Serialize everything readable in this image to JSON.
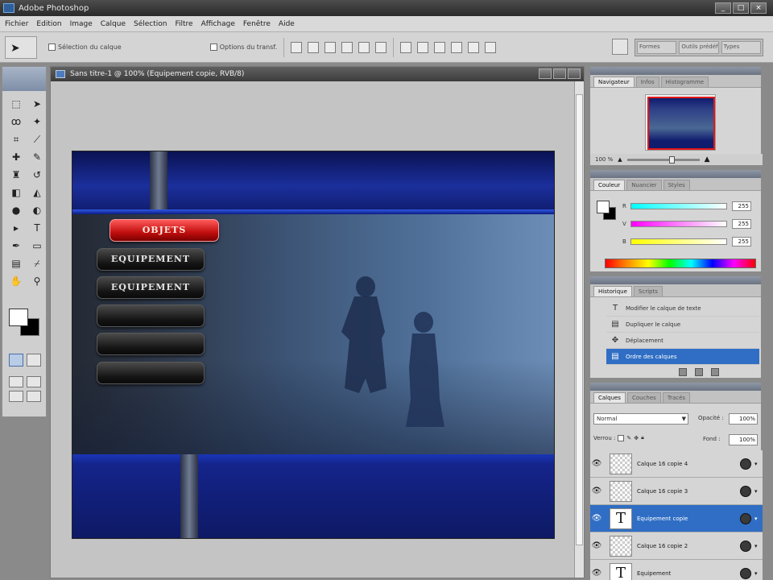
{
  "window": {
    "title": "Adobe Photoshop",
    "controls": [
      "_",
      "□",
      "×"
    ]
  },
  "menus": [
    "Fichier",
    "Edition",
    "Image",
    "Calque",
    "Sélection",
    "Filtre",
    "Affichage",
    "Fenêtre",
    "Aide"
  ],
  "options": {
    "auto_select": "Sélection du calque",
    "transform_controls": "Options du transf."
  },
  "well": [
    "Formes",
    "Outils prédéfinis",
    "Types"
  ],
  "document": {
    "title": "Sans titre-1 @ 100% (Equipement copie, RVB/8)"
  },
  "artwork": {
    "buttons": [
      {
        "label": "OBJETS",
        "selected": true
      },
      {
        "label": "EQUIPEMENT",
        "selected": false
      },
      {
        "label": "EQUIPEMENT",
        "selected": false
      },
      {
        "label": "",
        "selected": false
      },
      {
        "label": "",
        "selected": false
      },
      {
        "label": "",
        "selected": false
      }
    ]
  },
  "navigator": {
    "tabs": [
      "Navigateur",
      "Infos",
      "Histogramme"
    ],
    "zoom": "100 %"
  },
  "color": {
    "tabs": [
      "Couleur",
      "Nuancier",
      "Styles"
    ],
    "channels": [
      {
        "name": "R",
        "value": "255"
      },
      {
        "name": "V",
        "value": "255"
      },
      {
        "name": "B",
        "value": "255"
      }
    ],
    "foreground": "#ffffff",
    "background": "#000000"
  },
  "history": {
    "tabs": [
      "Historique",
      "Scripts"
    ],
    "items": [
      {
        "label": "Modifier le calque de texte",
        "icon": "T",
        "active": false
      },
      {
        "label": "Dupliquer le calque",
        "icon": "▤",
        "active": false
      },
      {
        "label": "Déplacement",
        "icon": "✥",
        "active": false
      },
      {
        "label": "Ordre des calques",
        "icon": "▤",
        "active": true
      }
    ]
  },
  "layers": {
    "tabs": [
      "Calques",
      "Couches",
      "Tracés"
    ],
    "blend_mode": "Normal",
    "opacity_label": "Opacité :",
    "opacity": "100%",
    "lock_label": "Verrou :",
    "fill_label": "Fond :",
    "fill": "100%",
    "items": [
      {
        "name": "Calque 16 copie 4",
        "type": "pixel",
        "active": false
      },
      {
        "name": "Calque 16 copie 3",
        "type": "pixel",
        "active": false
      },
      {
        "name": "Equipement copie",
        "type": "text",
        "active": true
      },
      {
        "name": "Calque 16 copie 2",
        "type": "pixel",
        "active": false
      },
      {
        "name": "Equipement",
        "type": "text",
        "active": false
      }
    ]
  }
}
